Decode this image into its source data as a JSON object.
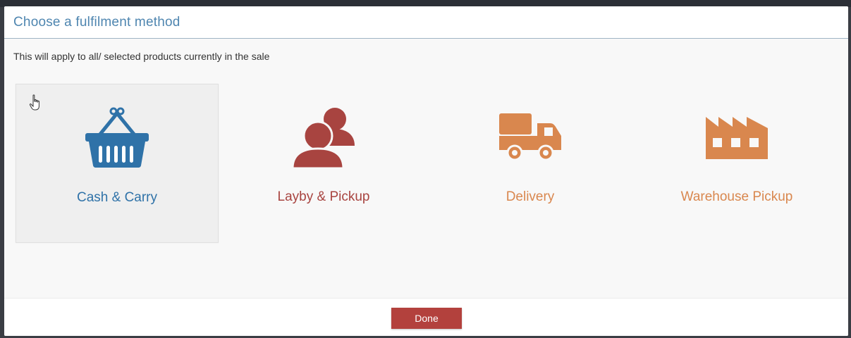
{
  "dialog": {
    "title": "Choose a fulfilment method",
    "subtitle": "This will apply to all/ selected products currently in the sale"
  },
  "options": [
    {
      "label": "Cash & Carry",
      "icon": "basket-icon",
      "color": "#2f72a8",
      "selected": true
    },
    {
      "label": "Layby & Pickup",
      "icon": "users-icon",
      "color": "#a84440",
      "selected": false
    },
    {
      "label": "Delivery",
      "icon": "truck-icon",
      "color": "#d9874e",
      "selected": false
    },
    {
      "label": "Warehouse Pickup",
      "icon": "factory-icon",
      "color": "#d9874e",
      "selected": false
    }
  ],
  "footer": {
    "done_label": "Done",
    "done_color": "#b3413d"
  }
}
